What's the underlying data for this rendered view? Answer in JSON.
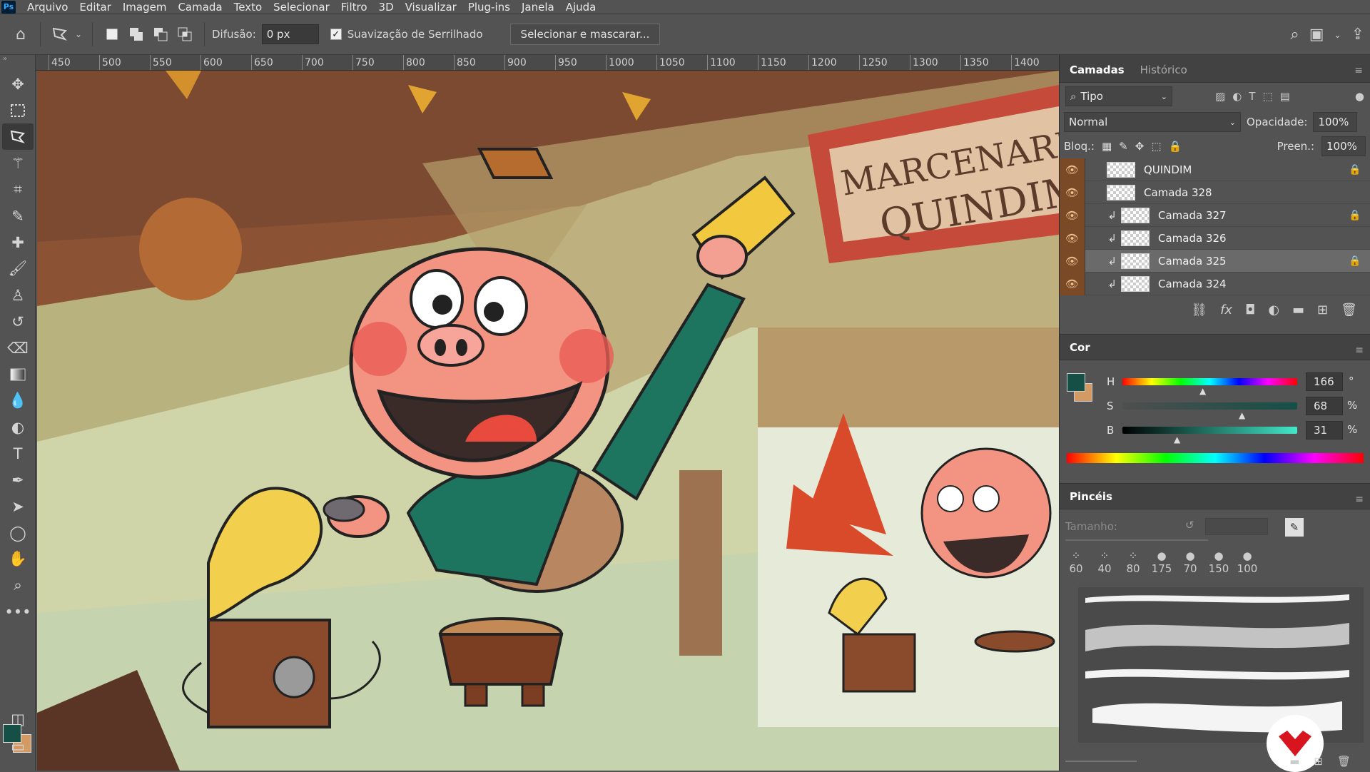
{
  "menu": {
    "logo": "Ps",
    "items": [
      "Arquivo",
      "Editar",
      "Imagem",
      "Camada",
      "Texto",
      "Selecionar",
      "Filtro",
      "3D",
      "Visualizar",
      "Plug-ins",
      "Janela",
      "Ajuda"
    ]
  },
  "options": {
    "feather_label": "Difusão:",
    "feather_value": "0 px",
    "antialias_label": "Suavização de Serrilhado",
    "antialias_checked": "✓",
    "select_mask_label": "Selecionar e mascarar..."
  },
  "ruler": {
    "ticks": [
      "450",
      "500",
      "550",
      "600",
      "650",
      "700",
      "750",
      "800",
      "850",
      "900",
      "950",
      "1000",
      "1050",
      "1100",
      "1150",
      "1200",
      "1250",
      "1300",
      "1350",
      "1400"
    ]
  },
  "canvas": {
    "sign_line1": "MARCENARIA",
    "sign_line2": "QUINDIM"
  },
  "layers_panel": {
    "tab_layers": "Camadas",
    "tab_history": "Histórico",
    "filter_label": "Tipo",
    "blend_mode": "Normal",
    "opacity_label": "Opacidade:",
    "opacity_value": "100%",
    "lock_label": "Bloq.:",
    "fill_label": "Preen.:",
    "fill_value": "100%",
    "layers": [
      {
        "name": "QUINDIM",
        "locked": true,
        "clipped": false,
        "selected": false
      },
      {
        "name": "Camada 328",
        "locked": false,
        "clipped": false,
        "selected": false
      },
      {
        "name": "Camada 327",
        "locked": true,
        "clipped": true,
        "selected": false
      },
      {
        "name": "Camada 326",
        "locked": false,
        "clipped": true,
        "selected": false
      },
      {
        "name": "Camada 325",
        "locked": true,
        "clipped": true,
        "selected": true
      },
      {
        "name": "Camada 324",
        "locked": false,
        "clipped": true,
        "selected": false
      }
    ]
  },
  "color_panel": {
    "title": "Cor",
    "h_label": "H",
    "h_value": "166",
    "h_unit": "°",
    "s_label": "S",
    "s_value": "68",
    "s_unit": "%",
    "b_label": "B",
    "b_value": "31",
    "b_unit": "%",
    "foreground_color": "#154f46",
    "background_color": "#d39a64"
  },
  "brushes_panel": {
    "title": "Pincéis",
    "size_label": "Tamanho:",
    "presets": [
      "60",
      "40",
      "80",
      "175",
      "70",
      "150",
      "100"
    ]
  },
  "colors": {
    "accent": "#d94a2b",
    "eye_cell": "#7a4a26"
  }
}
